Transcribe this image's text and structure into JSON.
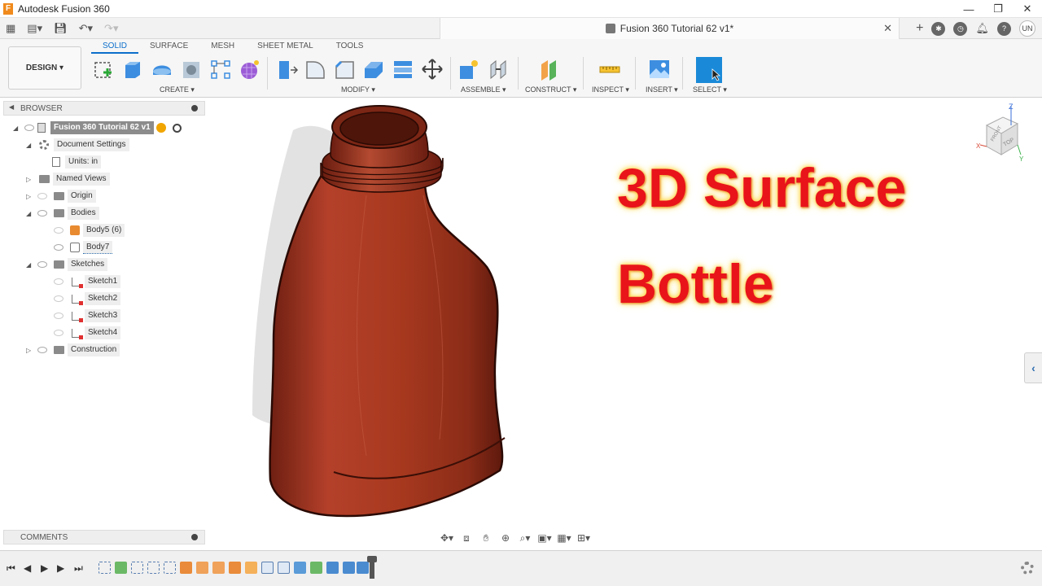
{
  "window": {
    "app_title": "Autodesk Fusion 360",
    "logo_letter": "F"
  },
  "document": {
    "tab_title": "Fusion 360 Tutorial 62 v1*"
  },
  "user": {
    "initials": "UN"
  },
  "ribbon": {
    "workspace": "DESIGN ▾",
    "tabs": [
      "SOLID",
      "SURFACE",
      "MESH",
      "SHEET METAL",
      "TOOLS"
    ],
    "active_tab": "SOLID",
    "groups": {
      "create": "CREATE ▾",
      "modify": "MODIFY ▾",
      "assemble": "ASSEMBLE ▾",
      "construct": "CONSTRUCT ▾",
      "inspect": "INSPECT ▾",
      "insert": "INSERT ▾",
      "select": "SELECT ▾"
    }
  },
  "browser": {
    "title": "BROWSER",
    "root": "Fusion 360 Tutorial 62 v1",
    "items": {
      "document_settings": "Document Settings",
      "units": "Units: in",
      "named_views": "Named Views",
      "origin": "Origin",
      "bodies": "Bodies",
      "body5": "Body5 (6)",
      "body7": "Body7",
      "sketches": "Sketches",
      "sketch1": "Sketch1",
      "sketch2": "Sketch2",
      "sketch3": "Sketch3",
      "sketch4": "Sketch4",
      "construction": "Construction"
    }
  },
  "viewport": {
    "overlay_line1": "3D Surface",
    "overlay_line2": "Bottle",
    "viewcube_front": "FRONT",
    "viewcube_top": "TOP",
    "axis_z": "Z",
    "axis_x": "X",
    "axis_y": "Y",
    "model_color": "#a83a26"
  },
  "comments": {
    "title": "COMMENTS"
  },
  "colors": {
    "accent": "#0c6ecb",
    "overlay_text": "#e8141a",
    "overlay_glow": "#ffd23a"
  }
}
